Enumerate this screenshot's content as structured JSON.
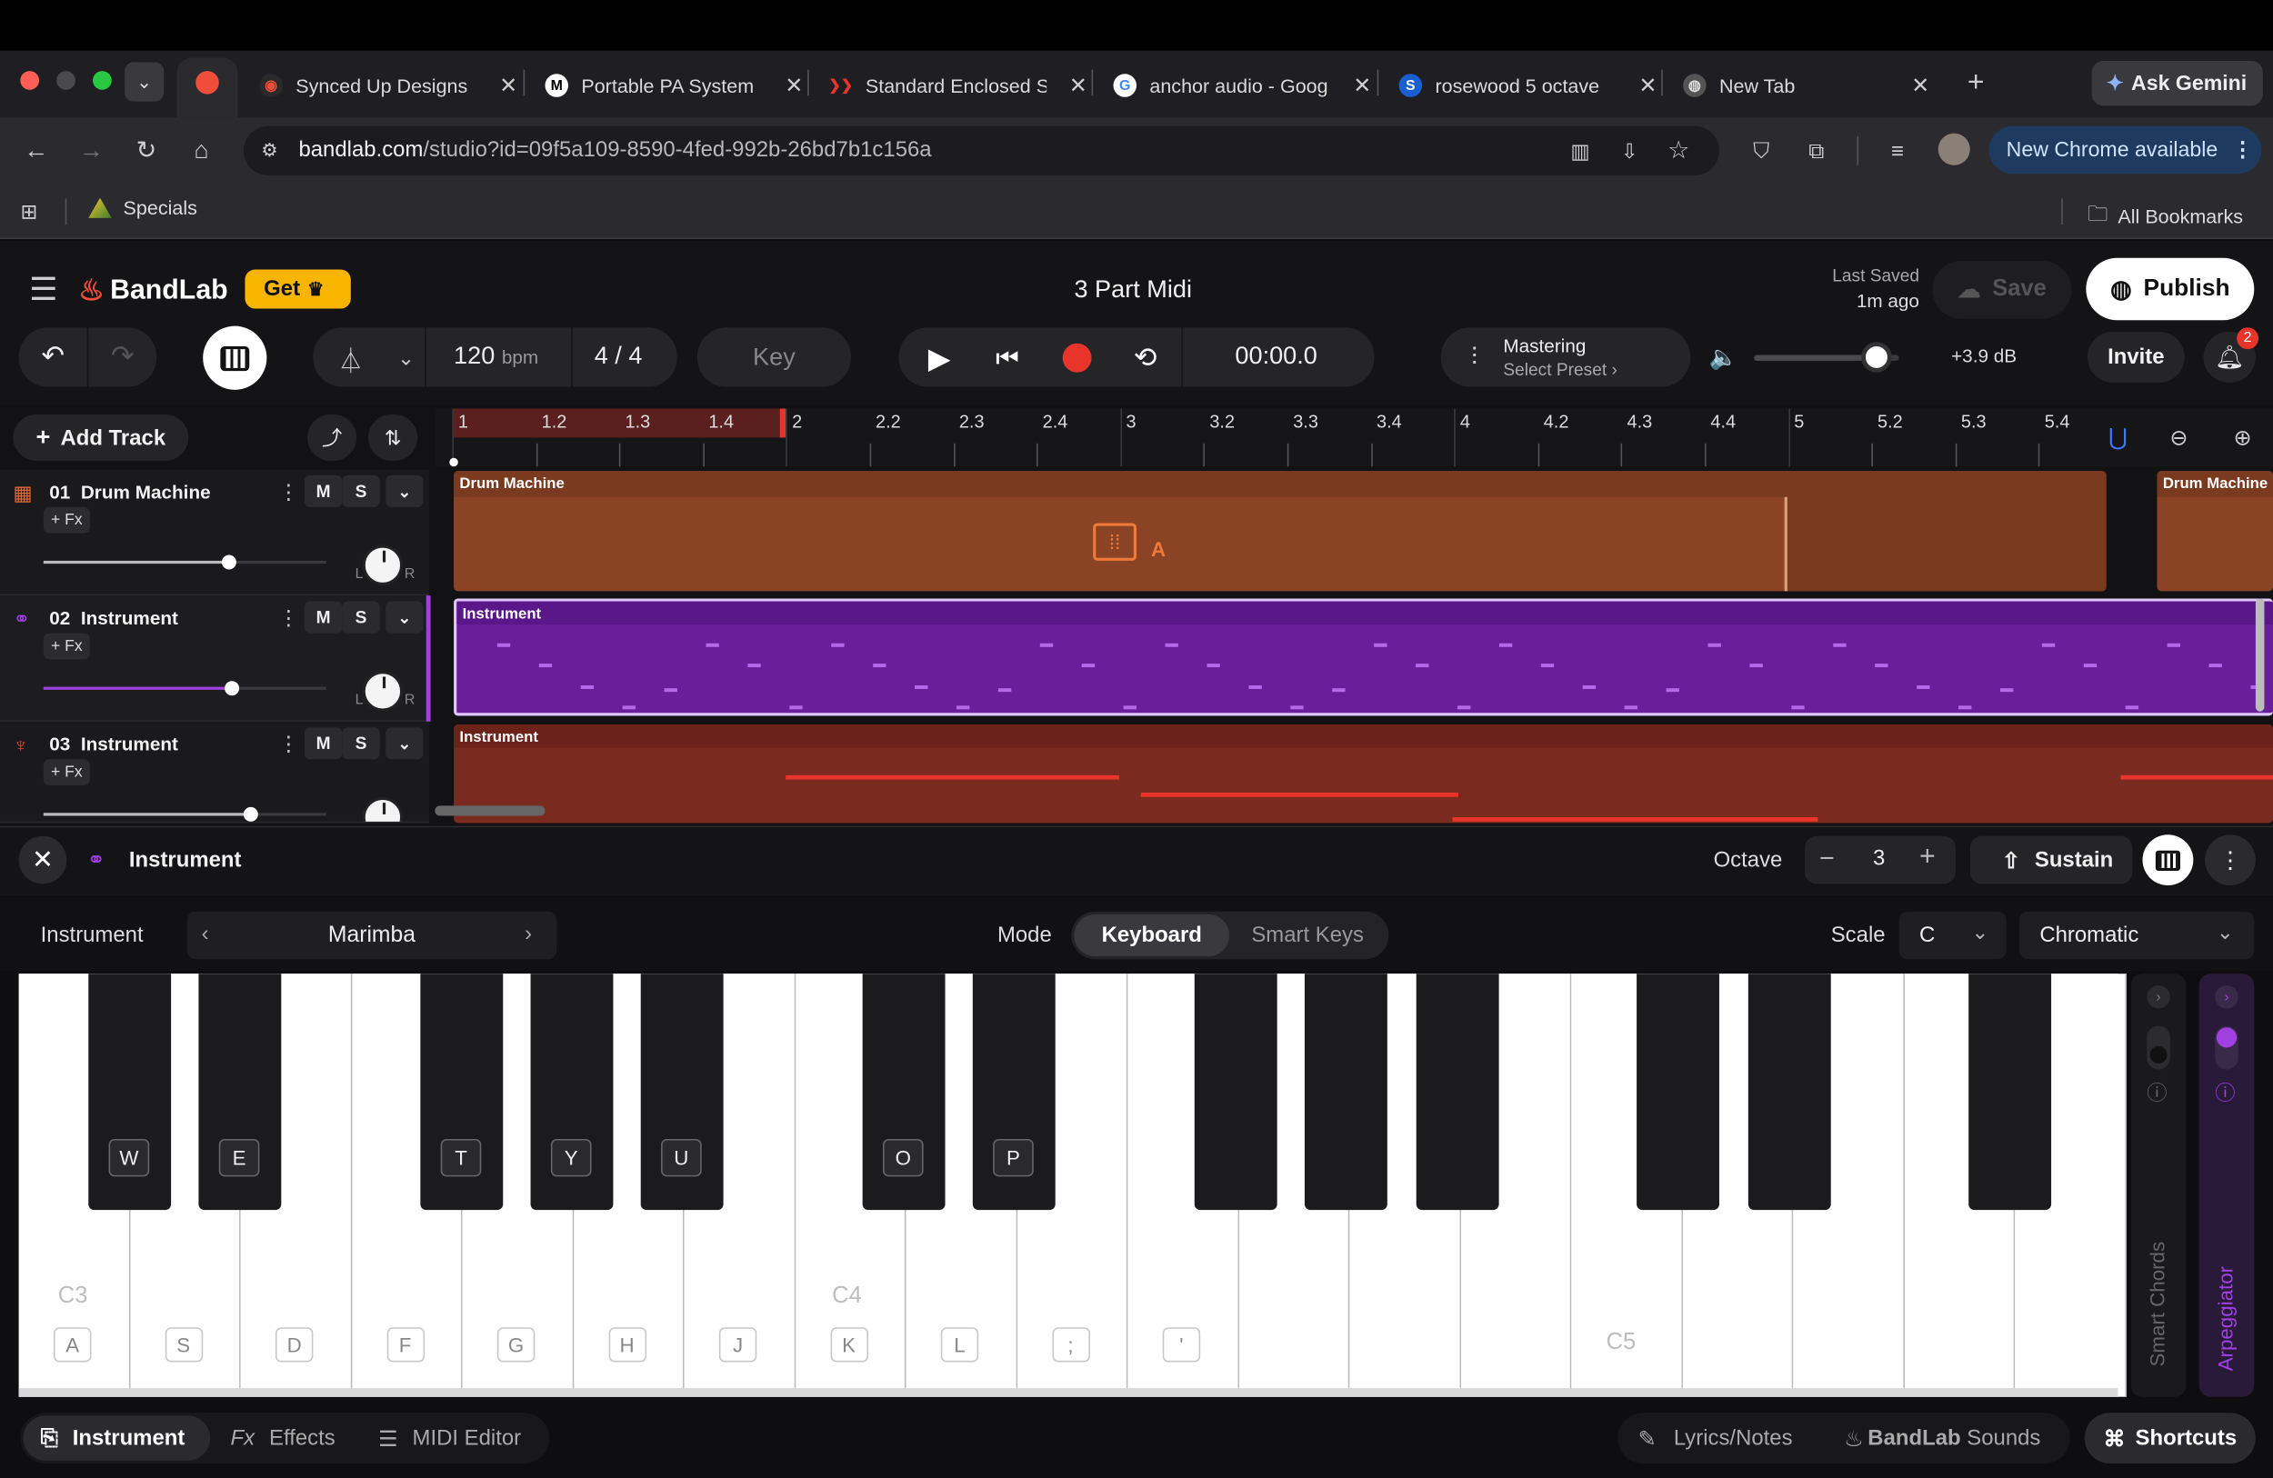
{
  "browser": {
    "tabs": [
      {
        "title": "Synced Up Designs",
        "icon": "bandlab-icon"
      },
      {
        "title": "Portable PA System",
        "icon": "m-icon"
      },
      {
        "title": "Standard Enclosed S",
        "icon": "arrows-icon"
      },
      {
        "title": "anchor audio - Goog",
        "icon": "google-icon"
      },
      {
        "title": "rosewood 5 octave",
        "icon": "s-icon"
      },
      {
        "title": "New Tab",
        "icon": "chrome-icon"
      }
    ],
    "ask_gemini": "Ask Gemini",
    "url_host": "bandlab.com",
    "url_path": "/studio?id=09f5a109-8590-4fed-992b-26bd7b1c156a",
    "new_chrome": "New Chrome available",
    "bookmarks": {
      "specials": "Specials",
      "all": "All Bookmarks"
    }
  },
  "app": {
    "logo": "BandLab",
    "get": "Get",
    "title": "3 Part Midi",
    "last_saved_label": "Last Saved",
    "last_saved_value": "1m ago",
    "save": "Save",
    "publish": "Publish",
    "tempo": "120",
    "bpm": "bpm",
    "time_sig": "4 / 4",
    "key": "Key",
    "time": "00:00.0",
    "mastering": "Mastering",
    "select_preset": "Select Preset",
    "db": "+3.9 dB",
    "invite": "Invite",
    "notifications": "2",
    "add_track": "Add Track"
  },
  "ruler": [
    "1",
    "1.2",
    "1.3",
    "1.4",
    "2",
    "2.2",
    "2.3",
    "2.4",
    "3",
    "3.2",
    "3.3",
    "3.4",
    "4",
    "4.2",
    "4.3",
    "4.4",
    "5",
    "5.2",
    "5.3",
    "5.4"
  ],
  "tracks": [
    {
      "num": "01",
      "name": "Drum Machine",
      "fx": "+ Fx",
      "m": "M",
      "s": "S",
      "color": "#e0683a",
      "clip": "Drum Machine",
      "clip2": "Drum Machine",
      "pad": "A"
    },
    {
      "num": "02",
      "name": "Instrument",
      "fx": "+ Fx",
      "m": "M",
      "s": "S",
      "color": "#a040e0",
      "clip": "Instrument"
    },
    {
      "num": "03",
      "name": "Instrument",
      "fx": "+ Fx",
      "m": "M",
      "s": "S",
      "color": "#e04a34",
      "clip": "Instrument"
    }
  ],
  "panel": {
    "title": "Instrument",
    "octave_label": "Octave",
    "octave": "3",
    "sustain": "Sustain",
    "instrument_label": "Instrument",
    "instrument": "Marimba",
    "mode_label": "Mode",
    "mode_keyboard": "Keyboard",
    "mode_smart": "Smart Keys",
    "scale_label": "Scale",
    "scale_root": "C",
    "scale_type": "Chromatic",
    "smart_chords": "Smart Chords",
    "arpeggiator": "Arpeggiator"
  },
  "keyboard": {
    "white": [
      "A",
      "S",
      "D",
      "F",
      "G",
      "H",
      "J",
      "K",
      "L",
      ";",
      "'",
      "",
      "",
      "",
      "",
      "",
      "",
      "",
      ""
    ],
    "black": [
      "W",
      "E",
      "T",
      "Y",
      "U",
      "O",
      "P",
      "",
      "",
      "",
      "",
      ""
    ],
    "notes": {
      "c3": "C3",
      "c4": "C4",
      "c5": "C5"
    }
  },
  "bottom": {
    "instrument": "Instrument",
    "effects": "Effects",
    "midi": "MIDI Editor",
    "lyrics": "Lyrics/Notes",
    "sounds_a": "BandLab",
    "sounds_b": "Sounds",
    "shortcuts": "Shortcuts"
  }
}
